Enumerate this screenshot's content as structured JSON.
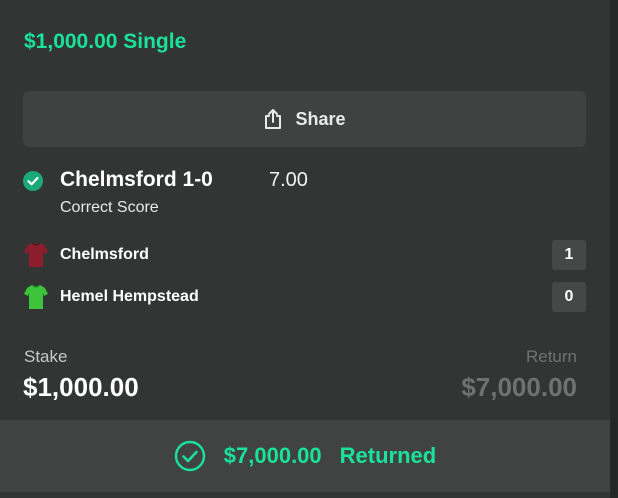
{
  "bet": {
    "title": "$1,000.00 Single",
    "share_label": "Share"
  },
  "selection": {
    "name": "Chelmsford 1-0",
    "odds": "7.00",
    "market": "Correct Score",
    "status_icon": "check-circle-icon"
  },
  "teams": [
    {
      "name": "Chelmsford",
      "score": "1",
      "shirt_color": "#8b1d2c",
      "icon": "shirt-icon"
    },
    {
      "name": "Hemel Hempstead",
      "score": "0",
      "shirt_color": "#3ec43a",
      "icon": "shirt-icon"
    }
  ],
  "stake": {
    "label": "Stake",
    "value": "$1,000.00"
  },
  "return": {
    "label": "Return",
    "value": "$7,000.00"
  },
  "footer": {
    "amount": "$7,000.00",
    "status": "Returned",
    "icon": "check-circle-icon"
  },
  "colors": {
    "accent": "#19e29c",
    "card_bg": "#333534",
    "button_bg": "#3f4241",
    "muted_text": "#6f7271"
  }
}
